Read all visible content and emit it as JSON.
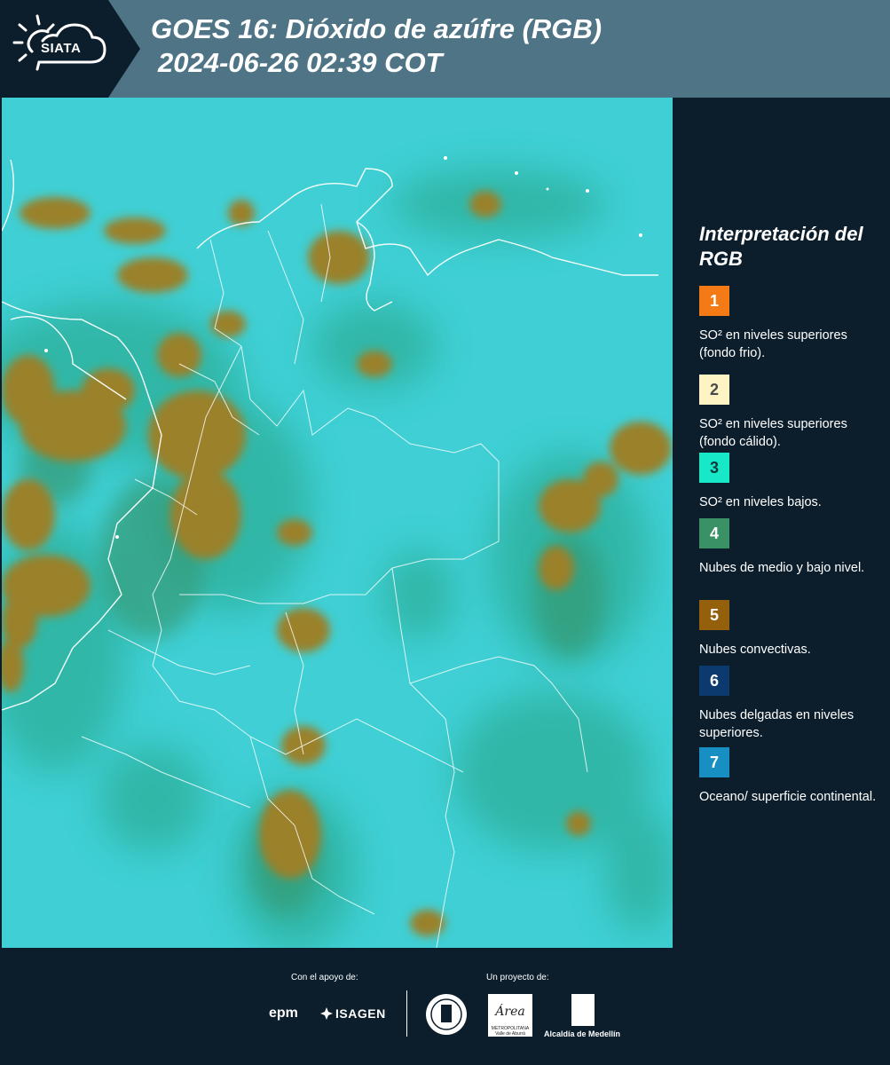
{
  "header": {
    "logo_text": "SIATA",
    "title_line1": "GOES 16: Dióxido de azúfre (RGB)",
    "title_line2": "2024-06-26 02:39 COT"
  },
  "legend": {
    "title": "Interpretación del RGB",
    "items": [
      {
        "number": "1",
        "color": "#f47a16",
        "text_color": "#ffffff",
        "label": "SO² en niveles superiores (fondo frio)."
      },
      {
        "number": "2",
        "color": "#fdf3c3",
        "text_color": "#4a4a4a",
        "label": "SO² en niveles superiores (fondo cálido)."
      },
      {
        "number": "3",
        "color": "#17e8c8",
        "text_color": "#0c3a3a",
        "label": "SO² en niveles bajos."
      },
      {
        "number": "4",
        "color": "#3a9165",
        "text_color": "#ffffff",
        "label": "Nubes de medio y bajo nivel."
      },
      {
        "number": "5",
        "color": "#94600c",
        "text_color": "#ffffff",
        "label": "Nubes convectivas."
      },
      {
        "number": "6",
        "color": "#0d3a6e",
        "text_color": "#ffffff",
        "label": "Nubes delgadas en niveles superiores."
      },
      {
        "number": "7",
        "color": "#178fc2",
        "text_color": "#ffffff",
        "label": "Oceano/ superficie continental."
      }
    ]
  },
  "footer": {
    "support_label": "Con el apoyo de:",
    "project_label": "Un proyecto de:",
    "sponsor1": "epm",
    "sponsor2": "ISAGEN",
    "area_name": "Área",
    "area_subtitle": "METROPOLITANA Valle de Aburrá",
    "alcaldia": "Alcaldía de Medellín"
  }
}
